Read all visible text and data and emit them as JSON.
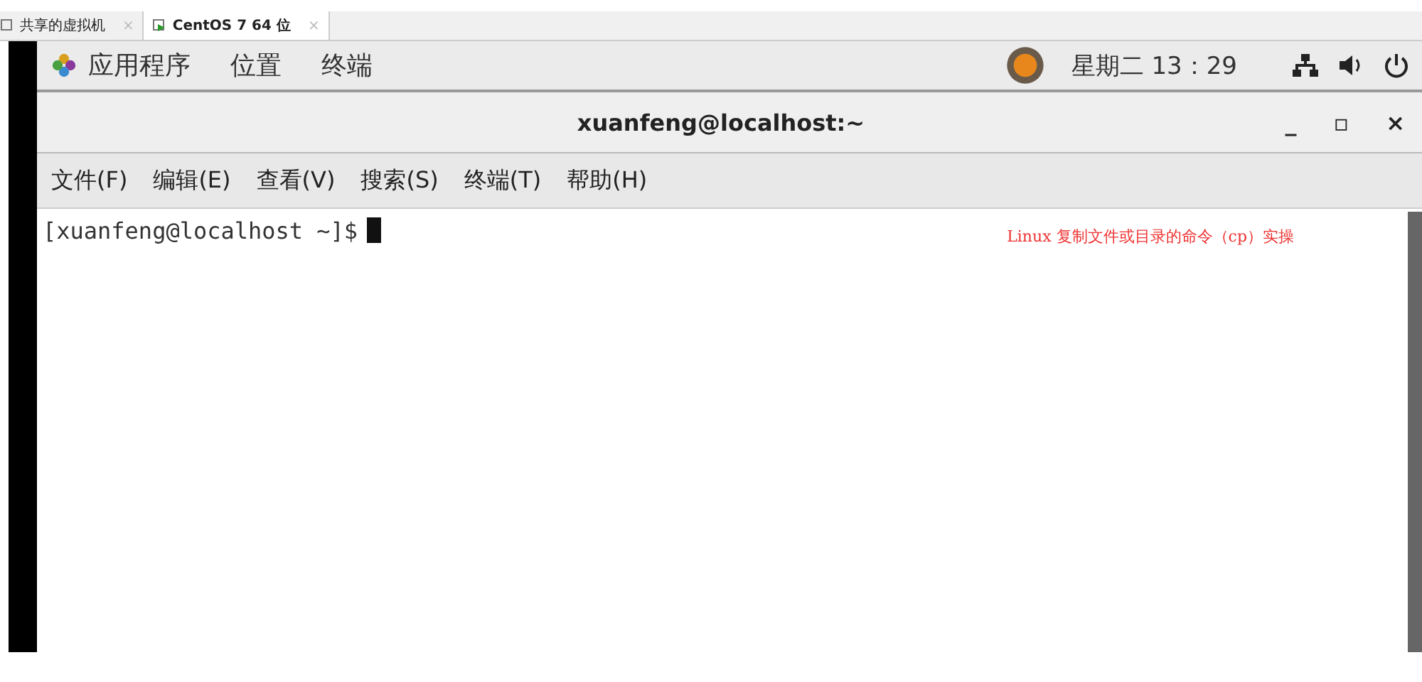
{
  "host_tabs": [
    {
      "label": "共享的虚拟机",
      "selected": false,
      "close": "×"
    },
    {
      "label": "CentOS 7 64 位",
      "selected": true,
      "close": "×"
    }
  ],
  "top_bar": {
    "menus": [
      "应用程序",
      "位置",
      "终端"
    ],
    "clock": "星期二 13：29"
  },
  "window": {
    "title": "xuanfeng@localhost:~",
    "controls": [
      "_",
      "▫",
      "×"
    ]
  },
  "menu_bar": [
    "文件(F)",
    "编辑(E)",
    "查看(V)",
    "搜索(S)",
    "终端(T)",
    "帮助(H)"
  ],
  "terminal": {
    "prompt": "[xuanfeng@localhost ~]$"
  },
  "annotation": "Linux 复制文件或目录的命令（cp）实操"
}
